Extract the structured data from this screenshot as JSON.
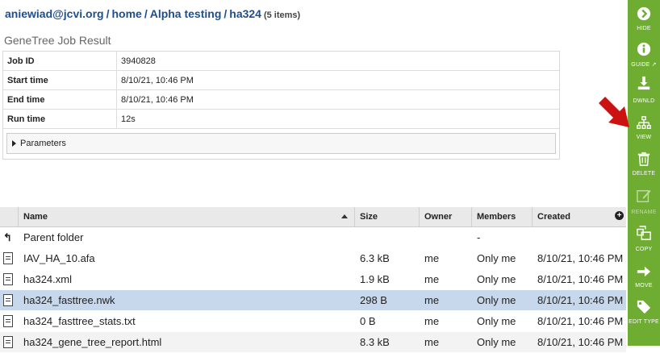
{
  "breadcrumb": {
    "user": "aniewiad@jcvi.org",
    "home": "home",
    "folder": "Alpha testing",
    "current": "ha324",
    "count": "(5 items)",
    "sep": "/"
  },
  "page_title": "GeneTree Job Result",
  "job": {
    "rows": [
      {
        "key": "Job ID",
        "value": "3940828"
      },
      {
        "key": "Start time",
        "value": "8/10/21, 10:46 PM"
      },
      {
        "key": "End time",
        "value": "8/10/21, 10:46 PM"
      },
      {
        "key": "Run time",
        "value": "12s"
      }
    ],
    "parameters_label": "Parameters"
  },
  "files": {
    "columns": {
      "name": "Name",
      "size": "Size",
      "owner": "Owner",
      "members": "Members",
      "created": "Created"
    },
    "add_column": "+",
    "parent": {
      "icon": "↰",
      "name": "Parent folder",
      "members": "-"
    },
    "rows": [
      {
        "name": "IAV_HA_10.afa",
        "size": "6.3 kB",
        "owner": "me",
        "members": "Only me",
        "created": "8/10/21, 10:46 PM"
      },
      {
        "name": "ha324.xml",
        "size": "1.9 kB",
        "owner": "me",
        "members": "Only me",
        "created": "8/10/21, 10:46 PM"
      },
      {
        "name": "ha324_fasttree.nwk",
        "size": "298 B",
        "owner": "me",
        "members": "Only me",
        "created": "8/10/21, 10:46 PM",
        "selected": true
      },
      {
        "name": "ha324_fasttree_stats.txt",
        "size": "0 B",
        "owner": "me",
        "members": "Only me",
        "created": "8/10/21, 10:46 PM"
      },
      {
        "name": "ha324_gene_tree_report.html",
        "size": "8.3 kB",
        "owner": "me",
        "members": "Only me",
        "created": "8/10/21, 10:46 PM"
      }
    ]
  },
  "sidebar": {
    "color": "#6ead32",
    "items": [
      {
        "label": "HIDE",
        "icon": "chevron-right-circle-icon"
      },
      {
        "label": "GUIDE",
        "icon": "info-icon"
      },
      {
        "label": "DWNLD",
        "icon": "download-icon"
      },
      {
        "label": "VIEW",
        "icon": "tree-icon"
      },
      {
        "label": "DELETE",
        "icon": "trash-icon"
      },
      {
        "label": "RENAME",
        "icon": "edit-icon"
      },
      {
        "label": "COPY",
        "icon": "copy-icon"
      },
      {
        "label": "MOVE",
        "icon": "arrow-right-icon"
      },
      {
        "label": "EDIT TYPE",
        "icon": "tag-icon"
      }
    ]
  },
  "annotation_color": "#cc1111"
}
